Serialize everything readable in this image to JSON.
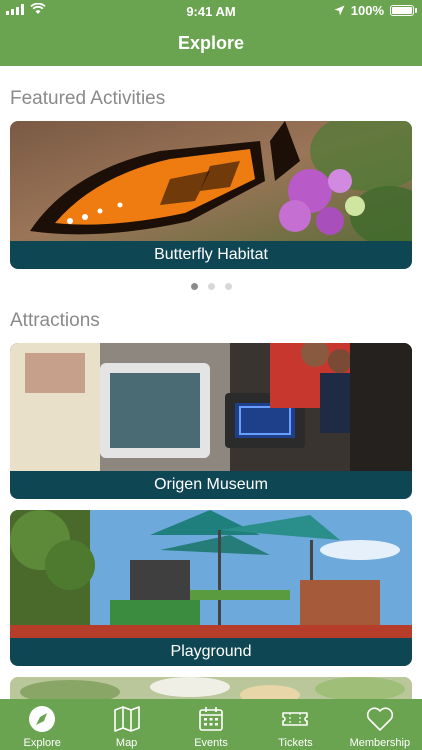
{
  "status_bar": {
    "time": "9:41 AM",
    "battery": "100%"
  },
  "nav": {
    "title": "Explore"
  },
  "featured": {
    "title": "Featured Activities",
    "items": [
      {
        "caption": "Butterfly Habitat"
      }
    ],
    "pager": {
      "pages": 3,
      "active": 1
    }
  },
  "attractions": {
    "title": "Attractions",
    "items": [
      {
        "caption": "Origen Museum"
      },
      {
        "caption": "Playground"
      }
    ]
  },
  "tabbar": {
    "tabs": [
      {
        "label": "Explore",
        "icon": "compass-icon"
      },
      {
        "label": "Map",
        "icon": "map-icon"
      },
      {
        "label": "Events",
        "icon": "calendar-icon"
      },
      {
        "label": "Tickets",
        "icon": "ticket-icon"
      },
      {
        "label": "Membership",
        "icon": "heart-icon"
      }
    ]
  },
  "colors": {
    "brand_green": "#6aa450",
    "caption_bg": "#0f4653",
    "section_gray": "#8a8a8a"
  }
}
